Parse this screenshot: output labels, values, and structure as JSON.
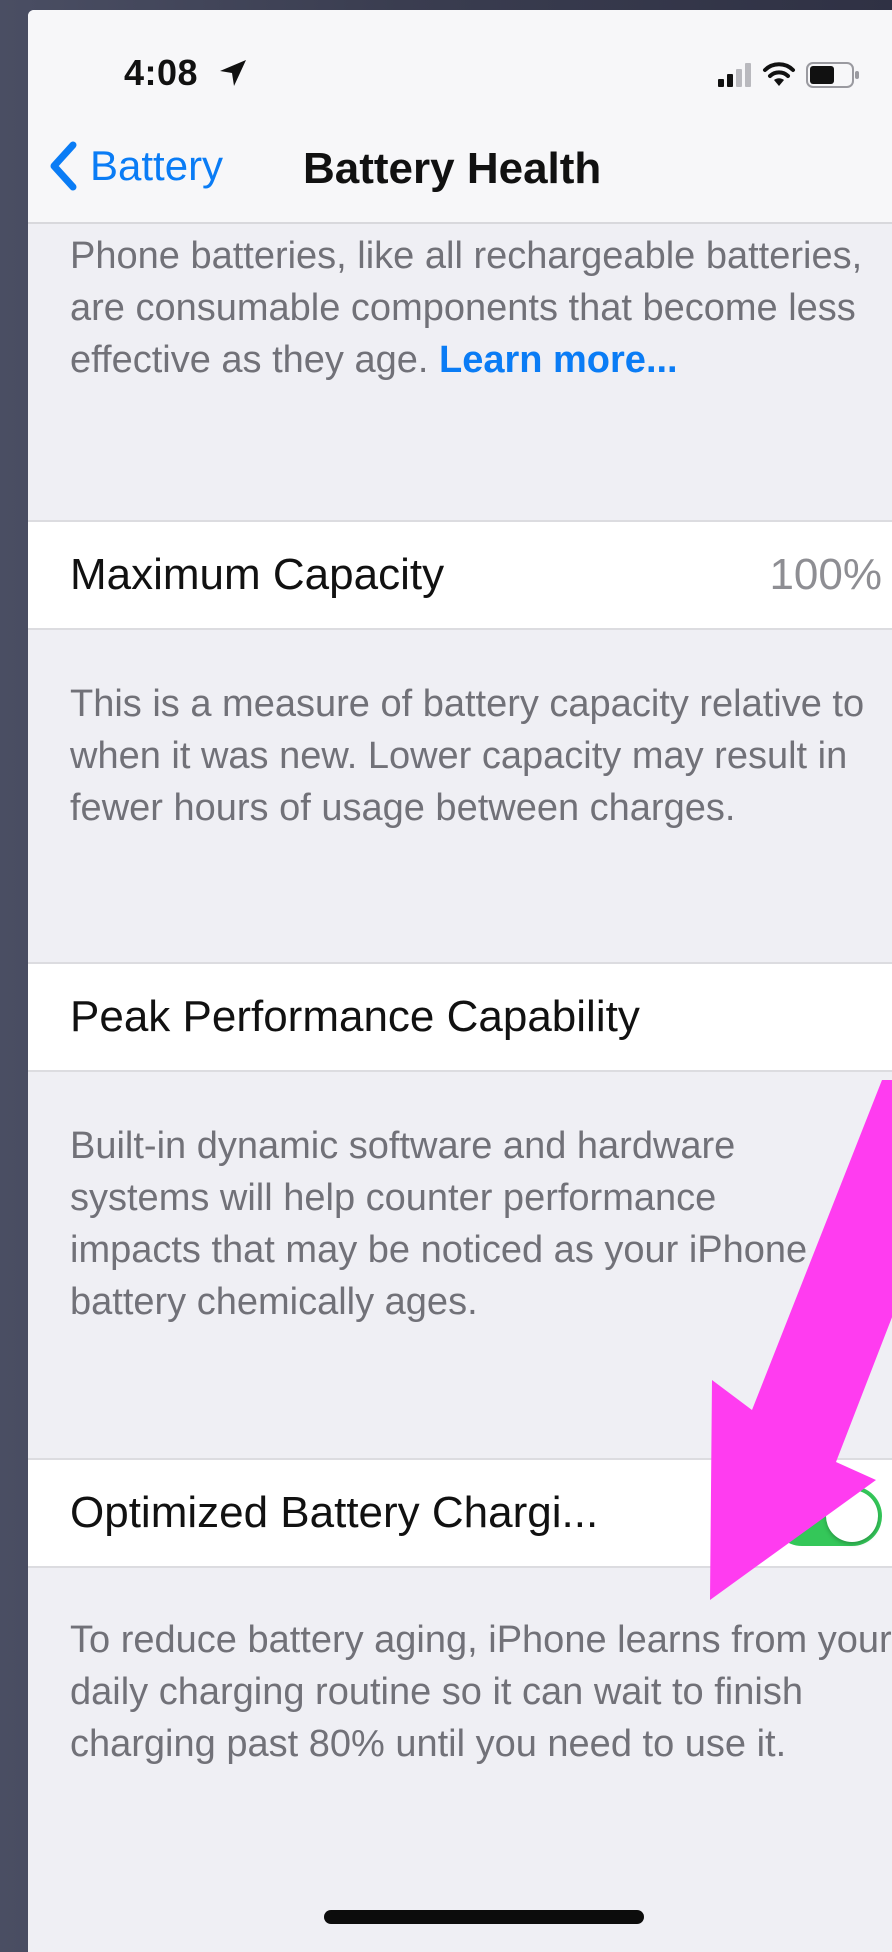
{
  "status_bar": {
    "time": "4:08",
    "icons": [
      "location-arrow-icon",
      "cellular-signal-icon",
      "wifi-icon",
      "battery-icon"
    ]
  },
  "nav": {
    "back_label": "Battery",
    "title": "Battery Health"
  },
  "intro": {
    "text": "Phone batteries, like all rechargeable batteries, are consumable components that become less effective as they age. ",
    "link": "Learn more..."
  },
  "maximum_capacity": {
    "label": "Maximum Capacity",
    "value": "100%",
    "footer": "This is a measure of battery capacity relative to when it was new. Lower capacity may result in fewer hours of usage between charges."
  },
  "peak_performance": {
    "label": "Peak Performance Capability",
    "footer": "Built-in dynamic software and hardware systems will help counter performance impacts that may be noticed as your iPhone battery chemically ages."
  },
  "optimized_charging": {
    "label": "Optimized Battery Chargi...",
    "enabled": true,
    "footer": "To reduce battery aging, iPhone learns from your daily charging routine so it can wait to finish charging past 80% until you need to use it."
  },
  "colors": {
    "accent": "#0a7cf5",
    "toggle_on": "#34c759",
    "annotation_arrow": "#ff3cf0"
  }
}
